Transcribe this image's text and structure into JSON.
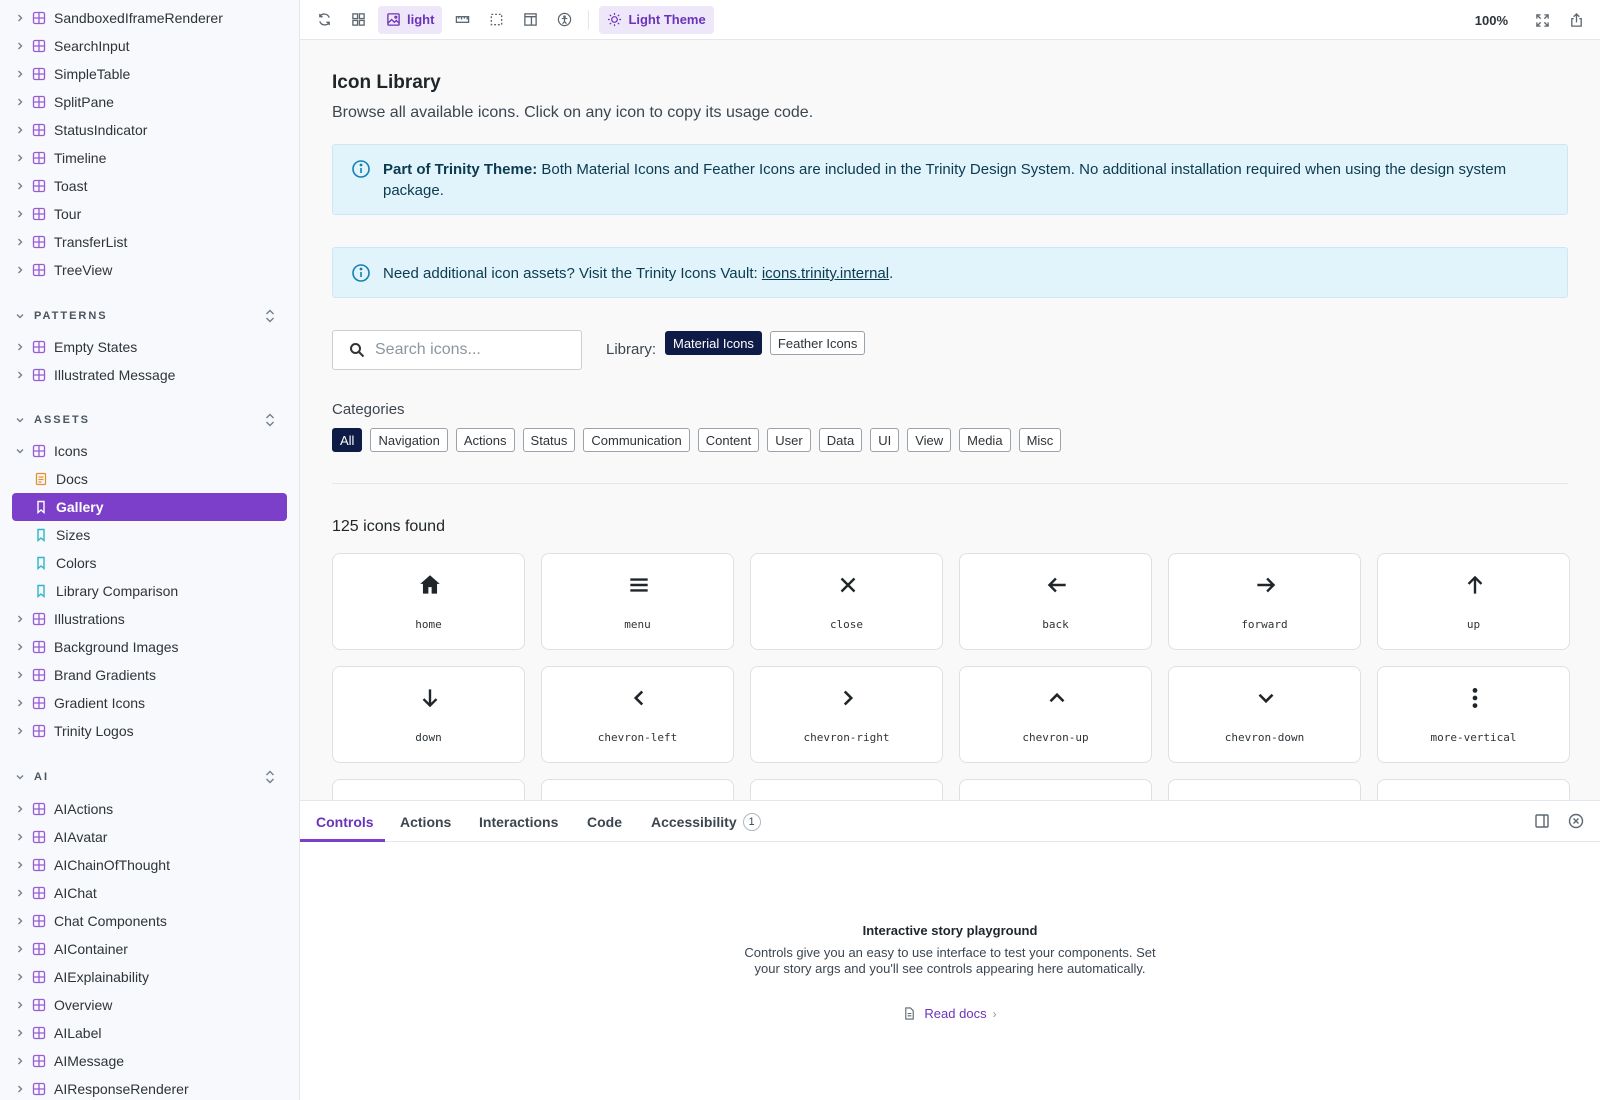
{
  "sidebar": {
    "top_items": [
      "SandboxedIframeRenderer",
      "SearchInput",
      "SimpleTable",
      "SplitPane",
      "StatusIndicator",
      "Timeline",
      "Toast",
      "Tour",
      "TransferList",
      "TreeView"
    ],
    "patterns": {
      "title": "PATTERNS",
      "items": [
        "Empty States",
        "Illustrated Message"
      ]
    },
    "assets": {
      "title": "ASSETS",
      "icons_label": "Icons",
      "icon_children": [
        "Docs",
        "Gallery",
        "Sizes",
        "Colors",
        "Library Comparison"
      ],
      "items": [
        "Illustrations",
        "Background Images",
        "Brand Gradients",
        "Gradient Icons",
        "Trinity Logos"
      ]
    },
    "ai": {
      "title": "AI",
      "items": [
        "AIActions",
        "AIAvatar",
        "AIChainOfThought",
        "AIChat",
        "Chat Components",
        "AIContainer",
        "AIExplainability",
        "Overview",
        "AILabel",
        "AIMessage",
        "AIResponseRenderer"
      ]
    }
  },
  "toolbar": {
    "background_label": "light",
    "theme_label": "Light Theme",
    "zoom": "100%"
  },
  "main": {
    "title": "Icon Library",
    "subtitle": "Browse all available icons. Click on any icon to copy its usage code.",
    "info1": {
      "strong": "Part of Trinity Theme:",
      "text": " Both Material Icons and Feather Icons are included in the Trinity Design System. No additional installation required when using the design system package."
    },
    "info2": {
      "text": "Need additional icon assets? Visit the Trinity Icons Vault: ",
      "link": "icons.trinity.internal",
      "suffix": "."
    },
    "search_placeholder": "Search icons...",
    "library_label": "Library:",
    "libraries": [
      "Material Icons",
      "Feather Icons"
    ],
    "categories_label": "Categories",
    "categories": [
      "All",
      "Navigation",
      "Actions",
      "Status",
      "Communication",
      "Content",
      "User",
      "Data",
      "UI",
      "View",
      "Media",
      "Misc"
    ],
    "count": "125 icons found",
    "icons": [
      {
        "name": "home",
        "icon": "home-icon"
      },
      {
        "name": "menu",
        "icon": "menu-icon"
      },
      {
        "name": "close",
        "icon": "close-icon"
      },
      {
        "name": "back",
        "icon": "arrow-back-icon"
      },
      {
        "name": "forward",
        "icon": "arrow-forward-icon"
      },
      {
        "name": "up",
        "icon": "arrow-up-icon"
      },
      {
        "name": "down",
        "icon": "arrow-down-icon"
      },
      {
        "name": "chevron-left",
        "icon": "chevron-left-icon"
      },
      {
        "name": "chevron-right",
        "icon": "chevron-right-icon"
      },
      {
        "name": "chevron-up",
        "icon": "chevron-up-icon"
      },
      {
        "name": "chevron-down",
        "icon": "chevron-down-icon"
      },
      {
        "name": "more-vertical",
        "icon": "more-vertical-icon"
      }
    ]
  },
  "panel": {
    "tabs": [
      "Controls",
      "Actions",
      "Interactions",
      "Code",
      "Accessibility"
    ],
    "accessibility_badge": "1",
    "empty_title": "Interactive story playground",
    "empty_desc": "Controls give you an easy to use interface to test your components. Set your story args and you'll see controls appearing here automatically.",
    "read_docs": "Read docs"
  },
  "colors": {
    "accent": "#7b3fc9",
    "chip_active": "#0f1b47",
    "info_bg": "#e1f3fb"
  }
}
